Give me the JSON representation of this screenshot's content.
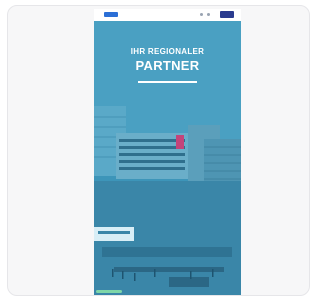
{
  "hero": {
    "line1": "IHR REGIONALER",
    "line2": "PARTNER"
  },
  "colors": {
    "overlay": "#3b8fb3",
    "menu": "#2a3b8f",
    "logo": "#2b6fd6"
  }
}
